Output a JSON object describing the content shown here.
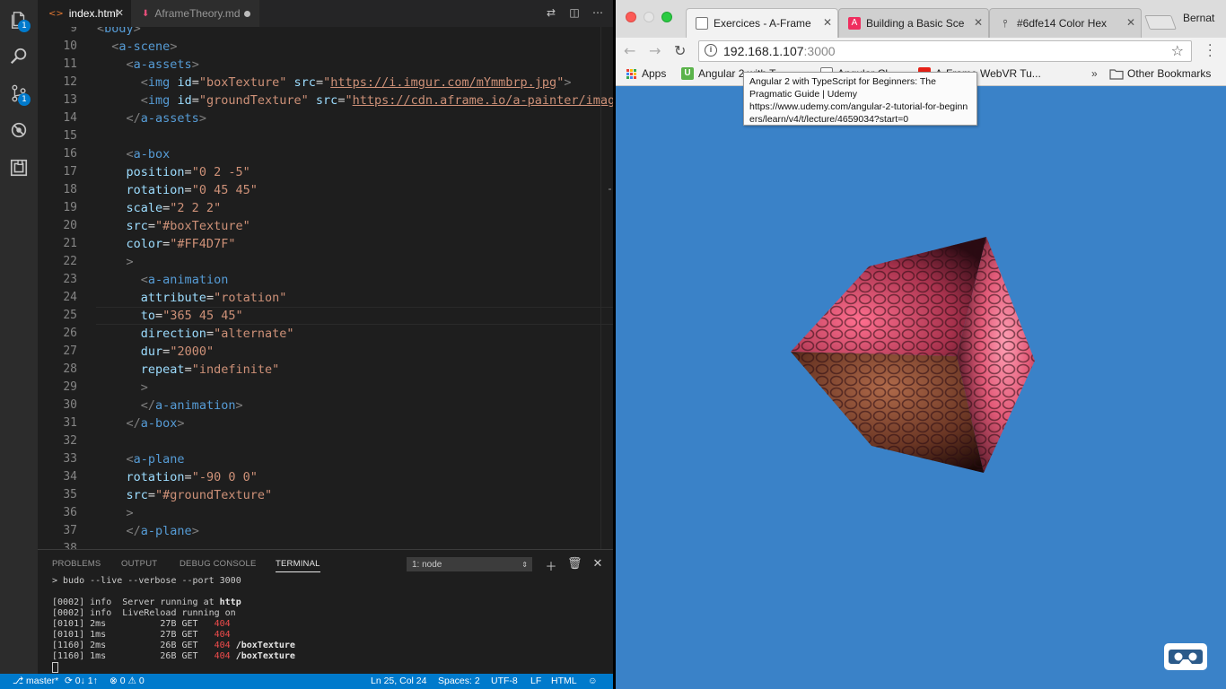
{
  "vscode": {
    "tabs": [
      {
        "label": "index.html",
        "active": true
      },
      {
        "label": "AframeTheory.md",
        "active": false,
        "modified": true
      }
    ],
    "activity_bar": [
      {
        "icon": "files-icon",
        "badge": "1"
      },
      {
        "icon": "search-icon"
      },
      {
        "icon": "git-icon",
        "badge": "1"
      },
      {
        "icon": "debug-icon"
      },
      {
        "icon": "extensions-icon"
      }
    ],
    "editor": {
      "first_line": 9,
      "line_numbers": [
        "9",
        "10",
        "11",
        "12",
        "13",
        "14",
        "15",
        "16",
        "17",
        "18",
        "19",
        "20",
        "21",
        "22",
        "23",
        "24",
        "25",
        "26",
        "27",
        "28",
        "29",
        "30",
        "31",
        "32",
        "33",
        "34",
        "35",
        "36",
        "37",
        "38"
      ],
      "lines": [
        "<body>",
        "  <a-scene>",
        "    <a-assets>",
        "      <img id=\"boxTexture\" src=\"https://i.imgur.com/mYmmbrp.jpg\">",
        "      <img id=\"groundTexture\" src=\"https://cdn.aframe.io/a-painter/images/floor.jpg\">",
        "    </a-assets>",
        "",
        "    <a-box",
        "    position=\"0 2 -5\"",
        "    rotation=\"0 45 45\"",
        "    scale=\"2 2 2\"",
        "    src=\"#boxTexture\"",
        "    color=\"#FF4D7F\"",
        "    >",
        "      <a-animation",
        "      attribute=\"rotation\"",
        "      to=\"365 45 45\"",
        "      direction=\"alternate\"",
        "      dur=\"2000\"",
        "      repeat=\"indefinite\"",
        "      >",
        "      </a-animation>",
        "    </a-box>",
        "",
        "    <a-plane",
        "    rotation=\"-90 0 0\"",
        "    src=\"#groundTexture\"",
        "    >",
        "    </a-plane>",
        ""
      ]
    },
    "panel": {
      "tabs": [
        "PROBLEMS",
        "OUTPUT",
        "DEBUG CONSOLE",
        "TERMINAL"
      ],
      "active_tab": "TERMINAL",
      "terminal_select": "1: node",
      "command": "> budo --live --verbose --port 3000",
      "output": [
        {
          "id": "[0002]",
          "a": "info",
          "b": "Server running at",
          "c": "http"
        },
        {
          "id": "[0002]",
          "a": "info",
          "b": "LiveReload running on",
          "c": ""
        },
        {
          "id": "[0101]",
          "a": "2ms",
          "b": "27B GET",
          "c": "404",
          "d": ""
        },
        {
          "id": "[0101]",
          "a": "1ms",
          "b": "27B GET",
          "c": "404",
          "d": ""
        },
        {
          "id": "[1160]",
          "a": "2ms",
          "b": "26B GET",
          "c": "404",
          "d": "/boxTexture"
        },
        {
          "id": "[1160]",
          "a": "1ms",
          "b": "26B GET",
          "c": "404",
          "d": "/boxTexture"
        }
      ]
    },
    "status": {
      "branch": "master*",
      "sync": "0↓ 1↑",
      "errors": "0",
      "warnings": "0",
      "position": "Ln 25, Col 24",
      "spaces": "Spaces: 2",
      "encoding": "UTF-8",
      "eol": "LF",
      "language": "HTML"
    }
  },
  "browser": {
    "tabs": [
      {
        "label": "Exercices - A-Frame",
        "active": true,
        "favicon_color": "#ffffff"
      },
      {
        "label": "Building a Basic Sce",
        "active": false,
        "favicon_color": "#ef2d5e"
      },
      {
        "label": "#6dfe14 Color Hex",
        "active": false,
        "favicon_color": "#333333"
      }
    ],
    "profile": "Bernat",
    "url_host": "192.168.1.107",
    "url_port": ":3000",
    "bookmarks": [
      {
        "label": "Apps",
        "icon": "apps-icon"
      },
      {
        "label": "Angular 2 with T...",
        "icon": "udemy-icon",
        "color": "#5ab34a"
      },
      {
        "label": "Angular Cl...",
        "icon": "page-icon"
      },
      {
        "label": "A-Frame WebVR Tu...",
        "icon": "youtube-icon",
        "color": "#e62117"
      }
    ],
    "overflow": "»",
    "other_bookmarks": "Other Bookmarks",
    "tooltip": {
      "title": "Angular 2 with TypeScript for Beginners: The Pragmatic Guide | Udemy",
      "url": "https://www.udemy.com/angular-2-tutorial-for-beginners/learn/v4/t/lecture/4659034?start=0"
    },
    "scene_color": "#3a82c8",
    "box_color": "#FF4D7F"
  }
}
